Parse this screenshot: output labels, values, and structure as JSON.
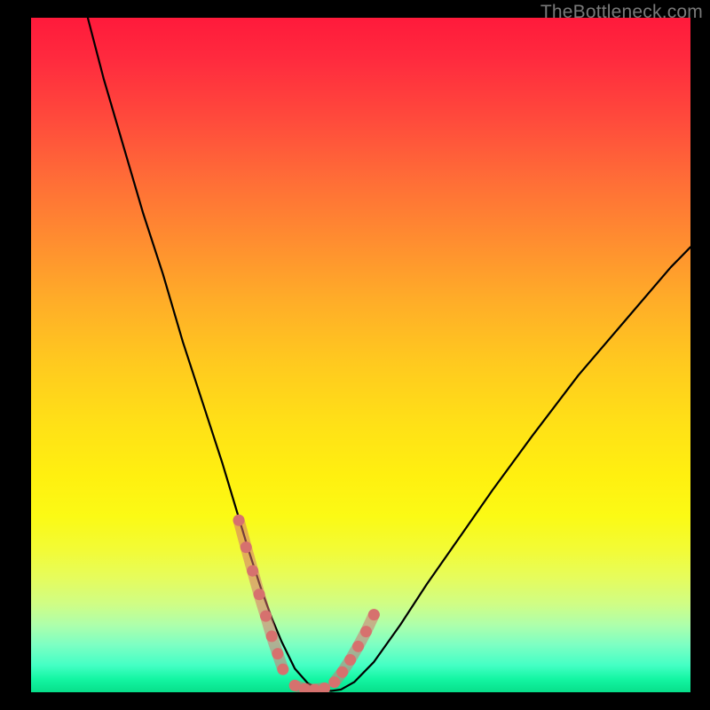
{
  "watermark": "TheBottleneck.com",
  "chart_data": {
    "type": "line",
    "title": "",
    "xlabel": "",
    "ylabel": "",
    "xlim": [
      0,
      100
    ],
    "ylim": [
      0,
      100
    ],
    "grid": false,
    "series": [
      {
        "name": "bottleneck-curve",
        "x": [
          8.6,
          11,
          14,
          17,
          20,
          23,
          26,
          29,
          31,
          33,
          35,
          36.5,
          38,
          40,
          42,
          44,
          45.5,
          47,
          49,
          52,
          56,
          60,
          65,
          70,
          76,
          83,
          90,
          97,
          100
        ],
        "y": [
          100,
          91,
          81,
          71,
          62,
          52,
          43,
          34,
          27.5,
          21,
          15,
          11,
          7.5,
          3.5,
          1.3,
          0.4,
          0.2,
          0.4,
          1.5,
          4.5,
          10,
          16,
          23,
          30,
          38,
          47,
          55,
          63,
          66
        ],
        "color": "#000000",
        "stroke_width": 2.2
      },
      {
        "name": "marker-left-segment",
        "x": [
          31.5,
          32.6,
          33.6,
          34.6,
          35.6,
          36.5,
          37.4,
          38.2
        ],
        "y": [
          25.5,
          21.5,
          18.0,
          14.5,
          11.3,
          8.3,
          5.7,
          3.4
        ],
        "color": "#d6716e",
        "stroke_width": 13,
        "style": "dotted"
      },
      {
        "name": "marker-bottom-segment",
        "x": [
          40.0,
          41.5,
          43.0,
          44.5
        ],
        "y": [
          1.0,
          0.5,
          0.4,
          0.6
        ],
        "color": "#d6716e",
        "stroke_width": 13,
        "style": "dotted"
      },
      {
        "name": "marker-right-segment",
        "x": [
          46.0,
          47.2,
          48.4,
          49.6,
          50.8,
          52.0
        ],
        "y": [
          1.5,
          3.0,
          4.8,
          6.8,
          9.0,
          11.5
        ],
        "color": "#d6716e",
        "stroke_width": 13,
        "style": "dotted"
      }
    ]
  }
}
